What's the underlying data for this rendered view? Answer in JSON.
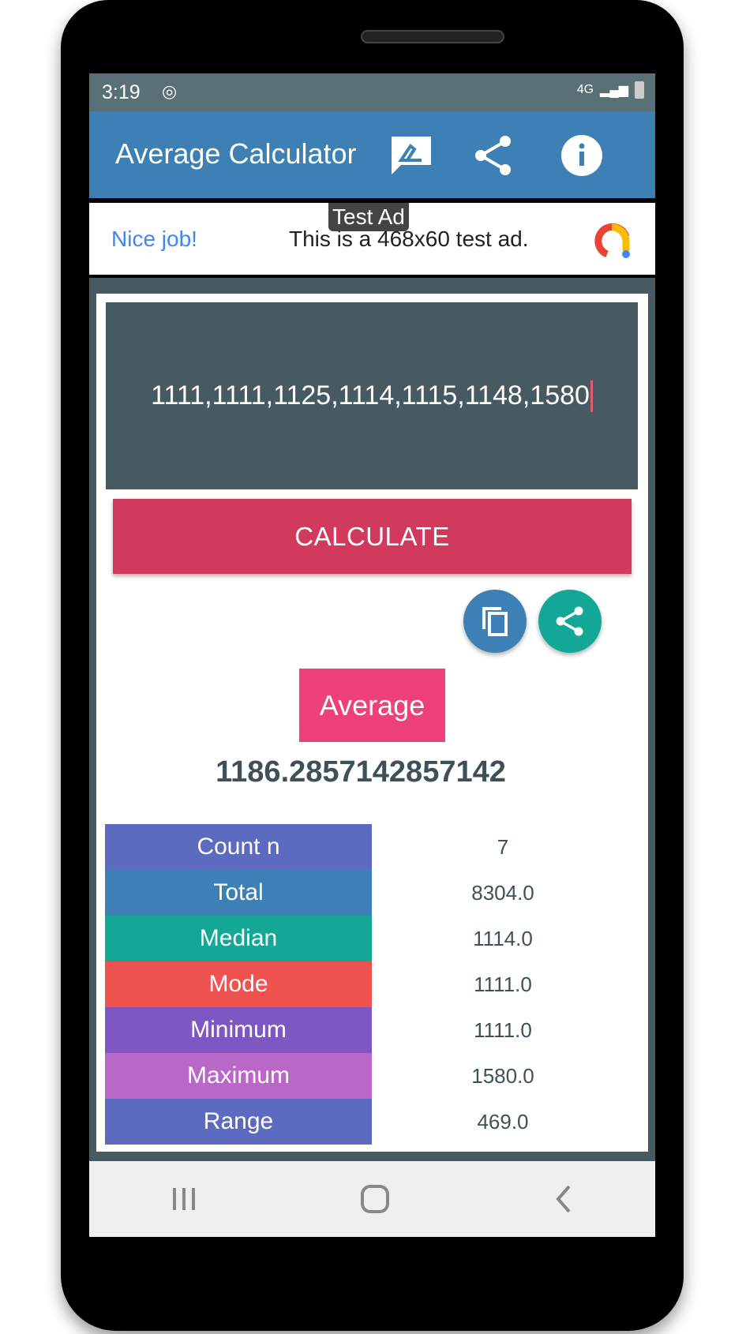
{
  "status_bar": {
    "time": "3:19",
    "network": "4G"
  },
  "app_bar": {
    "title": "Average Calculator",
    "icons": [
      "feedback-icon",
      "share-icon",
      "info-icon"
    ]
  },
  "ad": {
    "tag": "Test Ad",
    "headline": "Nice job!",
    "message": "This is a 468x60 test ad."
  },
  "input": {
    "value": "1111,1111,1125,1114,1115,1148,1580"
  },
  "calculate_label": "CALCULATE",
  "average": {
    "label": "Average",
    "value": "1186.2857142857142"
  },
  "stats": [
    {
      "label": "Count n",
      "value": "7",
      "color": "#5c6bc0"
    },
    {
      "label": "Total",
      "value": "8304.0",
      "color": "#3d80b5"
    },
    {
      "label": "Median",
      "value": "1114.0",
      "color": "#13a895"
    },
    {
      "label": "Mode",
      "value": "1111.0",
      "color": "#ef5350"
    },
    {
      "label": "Minimum",
      "value": "1111.0",
      "color": "#7e57c2"
    },
    {
      "label": "Maximum",
      "value": "1580.0",
      "color": "#ba68c8"
    },
    {
      "label": "Range",
      "value": "469.0",
      "color": "#5c6bc0"
    }
  ],
  "colors": {
    "app_bar": "#3d80b6",
    "calculate": "#d13a5c",
    "average": "#ee417a",
    "copy_fab": "#3d80b6",
    "share_fab": "#13a895"
  }
}
